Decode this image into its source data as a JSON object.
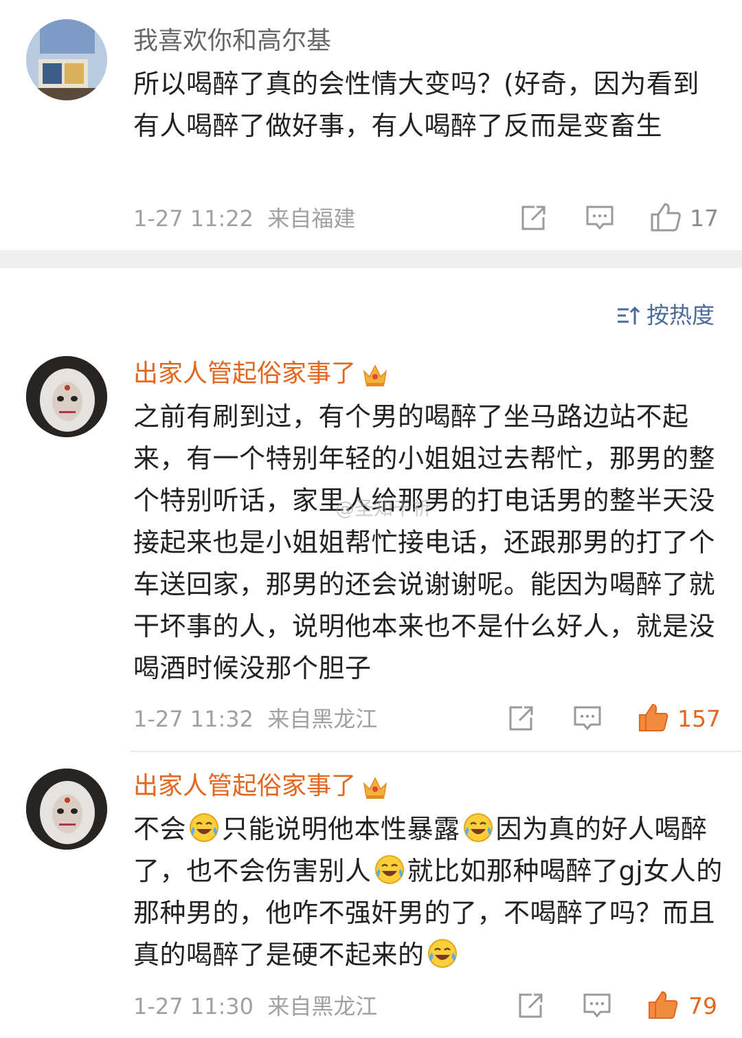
{
  "comment1": {
    "user": "我喜欢你和高尔基",
    "text": "所以喝醉了真的会性情大变吗？(好奇，因为看到有人喝醉了做好事，有人喝醉了反而是变畜生",
    "time": "1-27 11:22",
    "location": "来自福建",
    "likes": "17"
  },
  "sort_label": "按热度",
  "comment2": {
    "user": "出家人管起俗家事了",
    "text": "之前有刷到过，有个男的喝醉了坐马路边站不起来，有一个特别年轻的小姐姐过去帮忙，那男的整个特别听话，家里人给那男的打电话男的整半天没接起来也是小姐姐帮忙接电话，还跟那男的打了个车送回家，那男的还会说谢谢呢。能因为喝醉了就干坏事的人，说明他本来也不是什么好人，就是没喝酒时候没那个胆子",
    "time": "1-27 11:32",
    "location": "来自黑龙江",
    "likes": "157"
  },
  "comment3": {
    "user": "出家人管起俗家事了",
    "text_parts": [
      "不会",
      "只能说明他本性暴露",
      "因为真的好人喝醉了，也不会伤害别人",
      "就比如那种喝醉了gj女人的那种男的，他咋不强奸男的了，不喝醉了吗？而且真的喝醉了是硬不起来的"
    ],
    "time": "1-27 11:30",
    "location": "来自黑龙江",
    "likes": "79"
  },
  "watermark": "@圣知千祈",
  "colors": {
    "accent": "#e2661e",
    "sort": "#4b6b9a",
    "meta": "#a0a0a0"
  }
}
